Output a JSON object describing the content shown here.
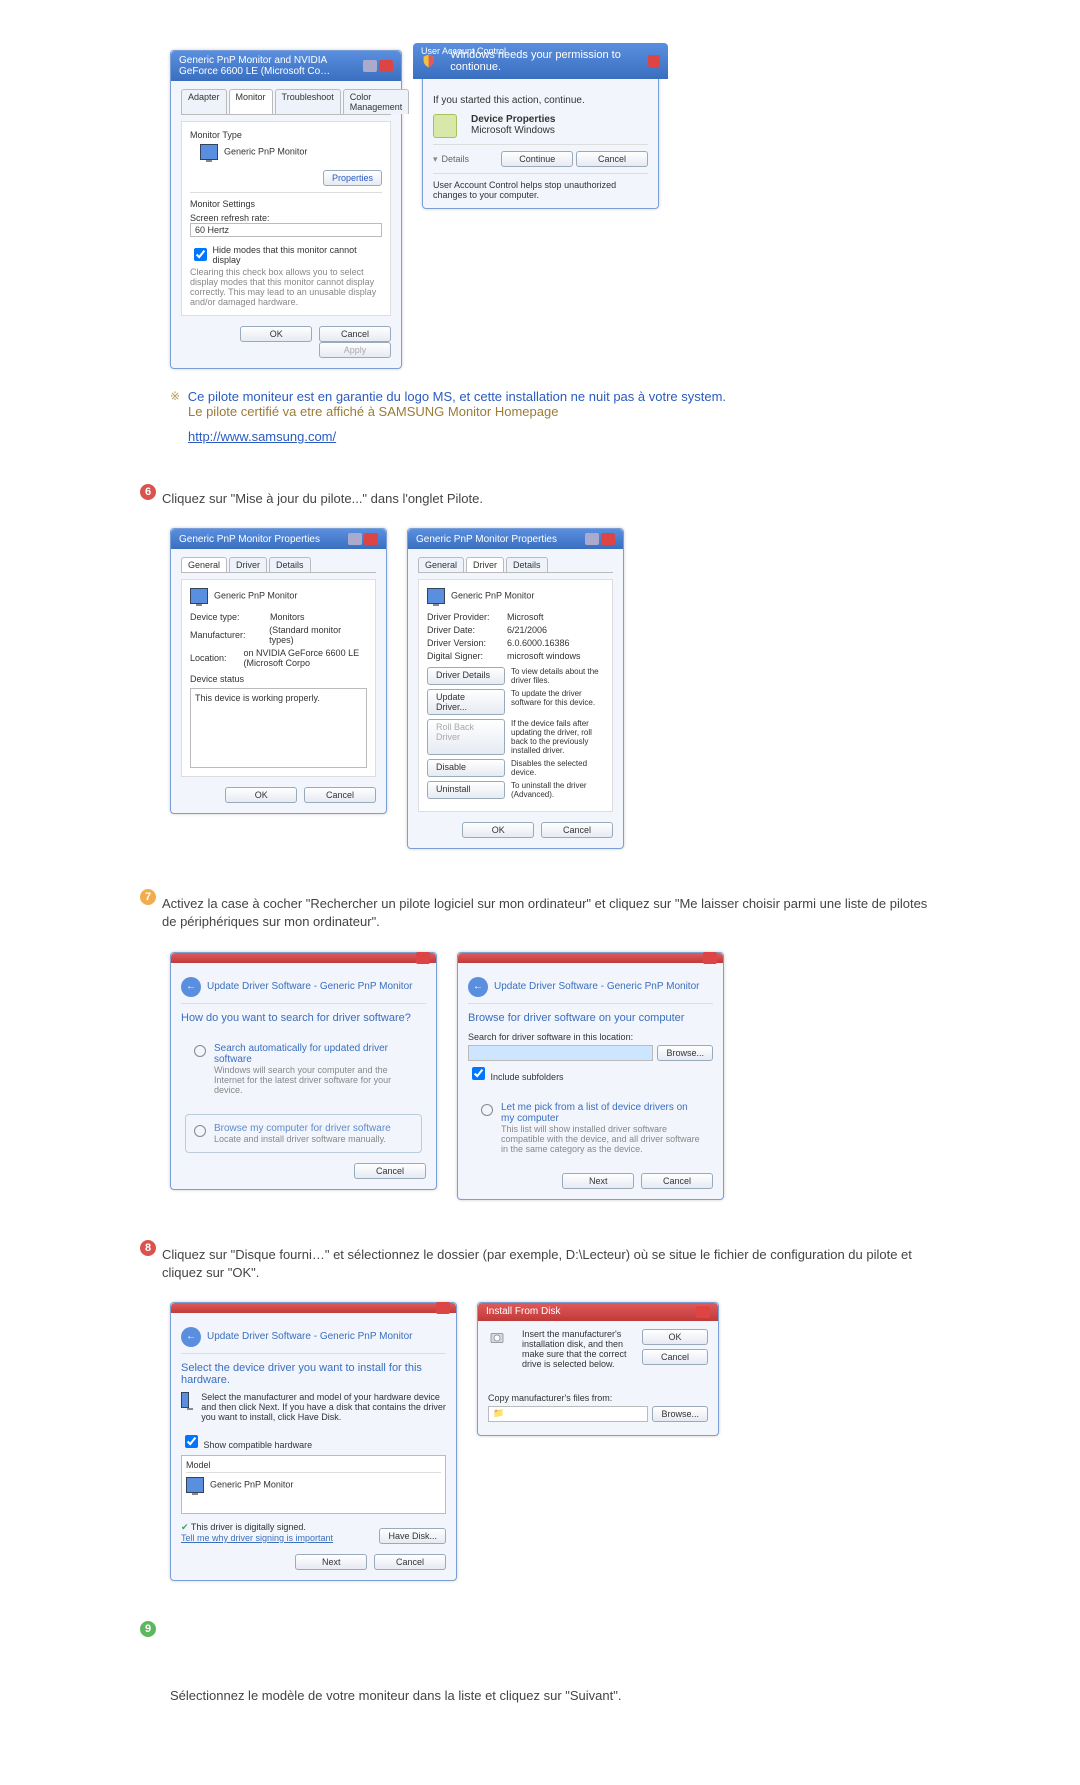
{
  "step5_images": {
    "monitor_props": {
      "title": "Generic PnP Monitor and NVIDIA GeForce 6600 LE (Microsoft Co…",
      "tabs": [
        "Adapter",
        "Monitor",
        "Troubleshoot",
        "Color Management"
      ],
      "monitor_type_label": "Monitor Type",
      "monitor_value": "Generic PnP Monitor",
      "properties_btn": "Properties",
      "settings_label": "Monitor Settings",
      "refresh_label": "Screen refresh rate:",
      "refresh_value": "60 Hertz",
      "hide_modes": "Hide modes that this monitor cannot display",
      "hide_modes_note": "Clearing this check box allows you to select display modes that this monitor cannot display correctly. This may lead to an unusable display and/or damaged hardware.",
      "ok": "OK",
      "cancel": "Cancel",
      "apply": "Apply"
    },
    "uac": {
      "title": "User Account Control",
      "banner": "Windows needs your permission to contionue.",
      "started": "If you started this action, continue.",
      "device_props": "Device Properties",
      "ms_windows": "Microsoft Windows",
      "details": "Details",
      "continue": "Continue",
      "cancel": "Cancel",
      "footer": "User Account Control helps stop unauthorized changes to your computer."
    }
  },
  "step5_note": {
    "line1": "Ce pilote moniteur est en garantie du logo MS, et cette installation ne nuit pas à votre system.",
    "line2": "Le pilote certifié va etre affiché à SAMSUNG Monitor Homepage",
    "link": "http://www.samsung.com/"
  },
  "step6": {
    "text": "Cliquez sur \"Mise à jour du pilote...\" dans l'onglet Pilote.",
    "dlg1": {
      "title": "Generic PnP Monitor Properties",
      "tabs": [
        "General",
        "Driver",
        "Details"
      ],
      "monitor": "Generic PnP Monitor",
      "device_type_l": "Device type:",
      "device_type_v": "Monitors",
      "manufacturer_l": "Manufacturer:",
      "manufacturer_v": "(Standard monitor types)",
      "location_l": "Location:",
      "location_v": "on NVIDIA GeForce 6600 LE (Microsoft Corpo",
      "status_l": "Device status",
      "status_v": "This device is working properly.",
      "ok": "OK",
      "cancel": "Cancel"
    },
    "dlg2": {
      "title": "Generic PnP Monitor Properties",
      "tabs": [
        "General",
        "Driver",
        "Details"
      ],
      "monitor": "Generic PnP Monitor",
      "provider_l": "Driver Provider:",
      "provider_v": "Microsoft",
      "date_l": "Driver Date:",
      "date_v": "6/21/2006",
      "version_l": "Driver Version:",
      "version_v": "6.0.6000.16386",
      "signer_l": "Digital Signer:",
      "signer_v": "microsoft windows",
      "btn_details": "Driver Details",
      "btn_details_d": "To view details about the driver files.",
      "btn_update": "Update Driver...",
      "btn_update_d": "To update the driver software for this device.",
      "btn_rollback": "Roll Back Driver",
      "btn_rollback_d": "If the device fails after updating the driver, roll back to the previously installed driver.",
      "btn_disable": "Disable",
      "btn_disable_d": "Disables the selected device.",
      "btn_uninstall": "Uninstall",
      "btn_uninstall_d": "To uninstall the driver (Advanced).",
      "ok": "OK",
      "cancel": "Cancel"
    }
  },
  "step7": {
    "text": "Activez la case à cocher \"Rechercher un pilote logiciel sur mon ordinateur\" et cliquez sur \"Me laisser choisir parmi une liste de pilotes de périphériques sur mon ordinateur\".",
    "dlg1": {
      "breadcrumb": "Update Driver Software - Generic PnP Monitor",
      "question": "How do you want to search for driver software?",
      "opt1_t": "Search automatically for updated driver software",
      "opt1_d": "Windows will search your computer and the Internet for the latest driver software for your device.",
      "opt2_t": "Browse my computer for driver software",
      "opt2_d": "Locate and install driver software manually.",
      "cancel": "Cancel"
    },
    "dlg2": {
      "breadcrumb": "Update Driver Software - Generic PnP Monitor",
      "heading": "Browse for driver software on your computer",
      "search_l": "Search for driver software in this location:",
      "browse": "Browse...",
      "include_sub": "Include subfolders",
      "opt_t": "Let me pick from a list of device drivers on my computer",
      "opt_d": "This list will show installed driver software compatible with the device, and all driver software in the same category as the device.",
      "next": "Next",
      "cancel": "Cancel"
    }
  },
  "step8": {
    "text": "Cliquez sur \"Disque fourni…\" et sélectionnez le dossier (par exemple, D:\\Lecteur) où se situe le fichier de configuration du pilote et cliquez sur \"OK\".",
    "dlg1": {
      "breadcrumb": "Update Driver Software - Generic PnP Monitor",
      "heading": "Select the device driver you want to install for this hardware.",
      "instr": "Select the manufacturer and model of your hardware device and then click Next. If you have a disk that contains the driver you want to install, click Have Disk.",
      "show_comp": "Show compatible hardware",
      "model_l": "Model",
      "model_v": "Generic PnP Monitor",
      "signed": "This driver is digitally signed.",
      "tell_me": "Tell me why driver signing is important",
      "have_disk": "Have Disk...",
      "next": "Next",
      "cancel": "Cancel"
    },
    "dlg2": {
      "title": "Install From Disk",
      "instr": "Insert the manufacturer's installation disk, and then make sure that the correct drive is selected below.",
      "ok": "OK",
      "cancel": "Cancel",
      "copy_l": "Copy manufacturer's files from:",
      "browse": "Browse..."
    }
  },
  "step9": {
    "text": "Sélectionnez le modèle de votre moniteur dans la liste et cliquez sur \"Suivant\"."
  }
}
